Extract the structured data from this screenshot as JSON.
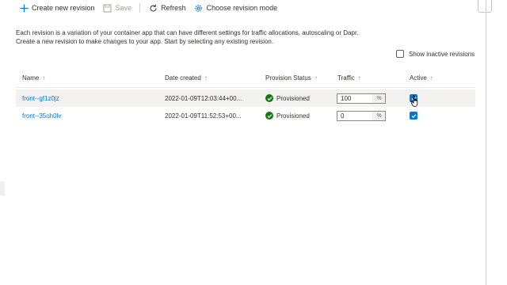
{
  "toolbar": {
    "create": {
      "label": "Create new revision",
      "icon": "plus-icon"
    },
    "save": {
      "label": "Save",
      "icon": "save-icon"
    },
    "refresh": {
      "label": "Refresh",
      "icon": "refresh-icon"
    },
    "mode": {
      "label": "Choose revision mode",
      "icon": "gear-icon"
    }
  },
  "description": {
    "line1": "Each revision is a variation of your container app that can have different settings for traffic allocations, autoscaling or Dapr.",
    "line2": "Create a new revision to make changes to your app. Start by selecting any existing revision."
  },
  "show_inactive": {
    "label": "Show inactive revisions",
    "checked": false
  },
  "table": {
    "columns": {
      "name": "Name",
      "date": "Date created",
      "status": "Provision Status",
      "traffic": "Traffic",
      "active": "Active"
    },
    "sort_glyph": "↑",
    "rows": [
      {
        "name": "front--gf1z0jz",
        "date": "2022-01-09T12:03:44+00...",
        "status": "Provisioned",
        "traffic": "100",
        "unit": "%",
        "active": true
      },
      {
        "name": "front--35oh0lv",
        "date": "2022-01-09T11:52:53+00...",
        "status": "Provisioned",
        "traffic": "0",
        "unit": "%",
        "active": true
      }
    ]
  },
  "colors": {
    "accent": "#0078d4",
    "success": "#107c10",
    "hover_row": "#f3f2f1"
  }
}
